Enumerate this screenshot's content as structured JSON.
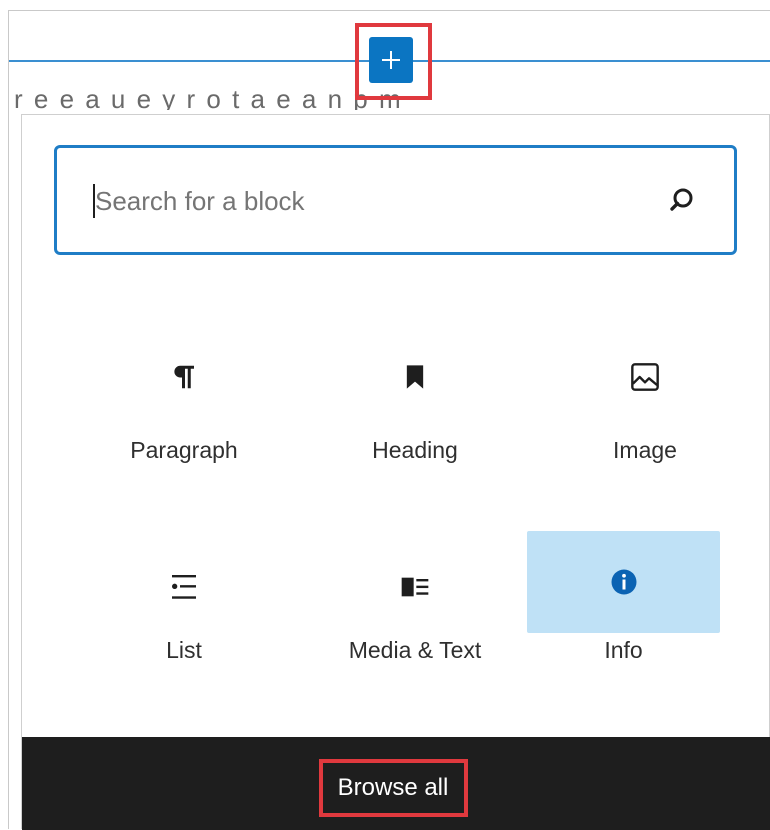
{
  "editor": {
    "ghost_text": "r e  e  a  u      e  y  r  o  t  a  e   a  n  p  m"
  },
  "inserter_toggle": {
    "icon": "plus-icon",
    "accent_color": "#0b75c2",
    "highlight_color": "#e0393e"
  },
  "search": {
    "placeholder": "Search for a block",
    "value": "",
    "icon": "search-icon"
  },
  "blocks": [
    {
      "label": "Paragraph",
      "icon": "paragraph-icon",
      "selected": false
    },
    {
      "label": "Heading",
      "icon": "bookmark-icon",
      "selected": false
    },
    {
      "label": "Image",
      "icon": "image-icon",
      "selected": false
    },
    {
      "label": "List",
      "icon": "list-icon",
      "selected": false
    },
    {
      "label": "Media & Text",
      "icon": "media-text-icon",
      "selected": false
    },
    {
      "label": "Info",
      "icon": "info-icon",
      "selected": true
    }
  ],
  "footer": {
    "browse_all_label": "Browse all"
  }
}
